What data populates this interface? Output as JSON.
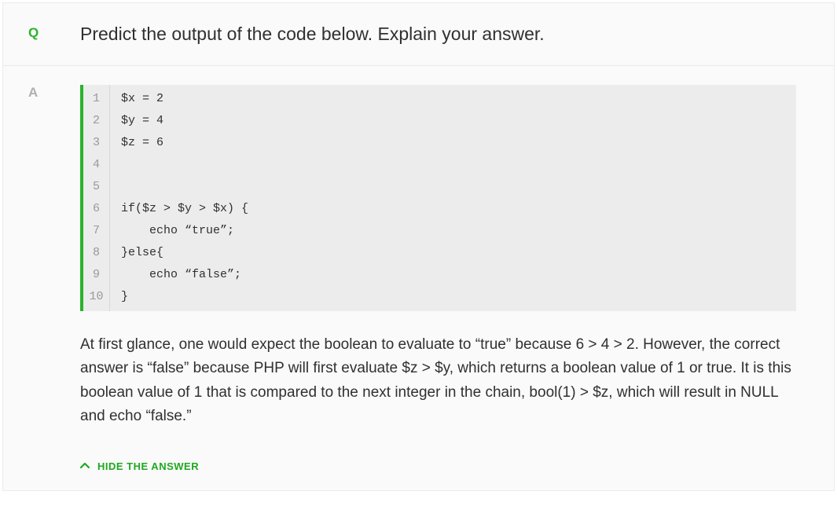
{
  "badges": {
    "q": "Q",
    "a": "A"
  },
  "question": "Predict the output of the code below. Explain your answer.",
  "code": {
    "lines": [
      "$x = 2",
      "$y = 4",
      "$z = 6",
      "",
      "",
      "if($z > $y > $x) {",
      "    echo “true”;",
      "}else{",
      "    echo “false”;",
      "}"
    ]
  },
  "explanation": "At first glance, one would expect the boolean to evaluate to “true” because 6 > 4 > 2. However, the correct answer is “false” because PHP will first evaluate $z > $y, which returns a boolean value of 1 or true. It is this boolean value of 1 that is compared to the next integer in the chain, bool(1) > $z, which will result in NULL and echo “false.”",
  "toggle": {
    "label": "HIDE THE ANSWER"
  }
}
